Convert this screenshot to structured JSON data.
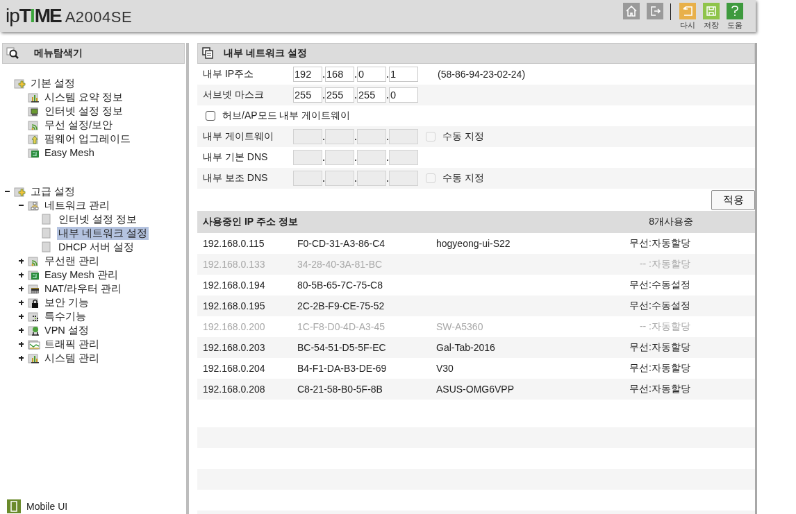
{
  "header": {
    "logo": "ipTIME",
    "model": "A2004SE",
    "toolbar": [
      {
        "kind": "home"
      },
      {
        "kind": "logout"
      },
      {
        "kind": "undo",
        "label": "다시"
      },
      {
        "kind": "save",
        "label": "저장"
      },
      {
        "kind": "help",
        "label": "도움"
      }
    ]
  },
  "sidebar": {
    "title": "메뉴탐색기",
    "tree": [
      {
        "label": "기본 설정",
        "kind": "folder-plus",
        "selected": false,
        "children": [
          {
            "label": "시스템 요약 정보",
            "kind": "chart",
            "selected": false
          },
          {
            "label": "인터넷 설정 정보",
            "kind": "monitor",
            "selected": false
          },
          {
            "label": "무선 설정/보안",
            "kind": "wifi",
            "selected": false
          },
          {
            "label": "펌웨어 업그레이드",
            "kind": "upload",
            "selected": false
          },
          {
            "label": "Easy Mesh",
            "kind": "mesh",
            "selected": false
          }
        ]
      },
      {
        "label": "고급 설정",
        "kind": "folder-plus",
        "expanded": true,
        "selected": false,
        "children": [
          {
            "label": "네트워크 관리",
            "kind": "network",
            "expanded": true,
            "selected": false,
            "children": [
              {
                "label": "인터넷 설정 정보",
                "kind": "page",
                "selected": false
              },
              {
                "label": "내부 네트워크 설정",
                "kind": "page",
                "selected": true
              },
              {
                "label": "DHCP 서버 설정",
                "kind": "page",
                "selected": false
              }
            ]
          },
          {
            "label": "무선랜 관리",
            "kind": "wifi",
            "expanded": false,
            "selected": false
          },
          {
            "label": "Easy Mesh 관리",
            "kind": "mesh",
            "expanded": false,
            "selected": false
          },
          {
            "label": "NAT/라우터 관리",
            "kind": "router",
            "expanded": false,
            "selected": false
          },
          {
            "label": "보안 기능",
            "kind": "lock",
            "expanded": false,
            "selected": false
          },
          {
            "label": "특수기능",
            "kind": "dots",
            "expanded": false,
            "selected": false
          },
          {
            "label": "VPN 설정",
            "kind": "vpn",
            "expanded": false,
            "selected": false
          },
          {
            "label": "트래픽 관리",
            "kind": "traffic",
            "expanded": false,
            "selected": false
          },
          {
            "label": "시스템 관리",
            "kind": "chart",
            "expanded": false,
            "selected": false
          }
        ]
      }
    ],
    "mobile_link": "Mobile UI"
  },
  "panel": {
    "title": "내부 네트워크 설정",
    "rows": [
      {
        "kind": "ip",
        "label": "내부 IP주소",
        "octets": [
          "192",
          "168",
          "0",
          "1"
        ],
        "disabled": false,
        "note": "(58-86-94-23-02-24)"
      },
      {
        "kind": "ip",
        "label": "서브넷 마스크",
        "octets": [
          "255",
          "255",
          "255",
          "0"
        ],
        "disabled": false
      },
      {
        "kind": "checkbox",
        "label": "허브/AP모드 내부 게이트웨이",
        "checked": false
      },
      {
        "kind": "ip",
        "label": "내부 게이트웨이",
        "disabled": true,
        "manual": {
          "label": "수동 지정",
          "checked": false,
          "disabled": true
        }
      },
      {
        "kind": "ip",
        "label": "내부 기본 DNS",
        "disabled": true
      },
      {
        "kind": "ip",
        "label": "내부 보조 DNS",
        "disabled": true,
        "manual": {
          "label": "수동 지정",
          "checked": false,
          "disabled": true
        }
      }
    ],
    "apply_button": "적용",
    "table": {
      "title": "사용중인 IP 주소 정보",
      "count": "8개사용중",
      "rows": [
        {
          "ip": "192.168.0.115",
          "mac": "F0-CD-31-A3-86-C4",
          "name": "hogyeong-ui-S22",
          "status": "무선:자동할당",
          "inactive": false
        },
        {
          "ip": "192.168.0.133",
          "mac": "34-28-40-3A-81-BC",
          "status": "-- :자동할당",
          "inactive": true
        },
        {
          "ip": "192.168.0.194",
          "mac": "80-5B-65-7C-75-C8",
          "status": "무선:수동설정",
          "inactive": false
        },
        {
          "ip": "192.168.0.195",
          "mac": "2C-2B-F9-CE-75-52",
          "status": "무선:수동설정",
          "inactive": false
        },
        {
          "ip": "192.168.0.200",
          "mac": "1C-F8-D0-4D-A3-45",
          "name": "SW-A5360",
          "status": "-- :자동할당",
          "inactive": true
        },
        {
          "ip": "192.168.0.203",
          "mac": "BC-54-51-D5-5F-EC",
          "name": "Gal-Tab-2016",
          "status": "무선:자동할당",
          "inactive": false
        },
        {
          "ip": "192.168.0.204",
          "mac": "B4-F1-DA-B3-DE-69",
          "name": "V30",
          "status": "무선:자동할당",
          "inactive": false
        },
        {
          "ip": "192.168.0.208",
          "mac": "C8-21-58-B0-5F-8B",
          "name": "ASUS-OMG6VPP",
          "status": "무선:자동할당",
          "inactive": false
        }
      ]
    }
  }
}
